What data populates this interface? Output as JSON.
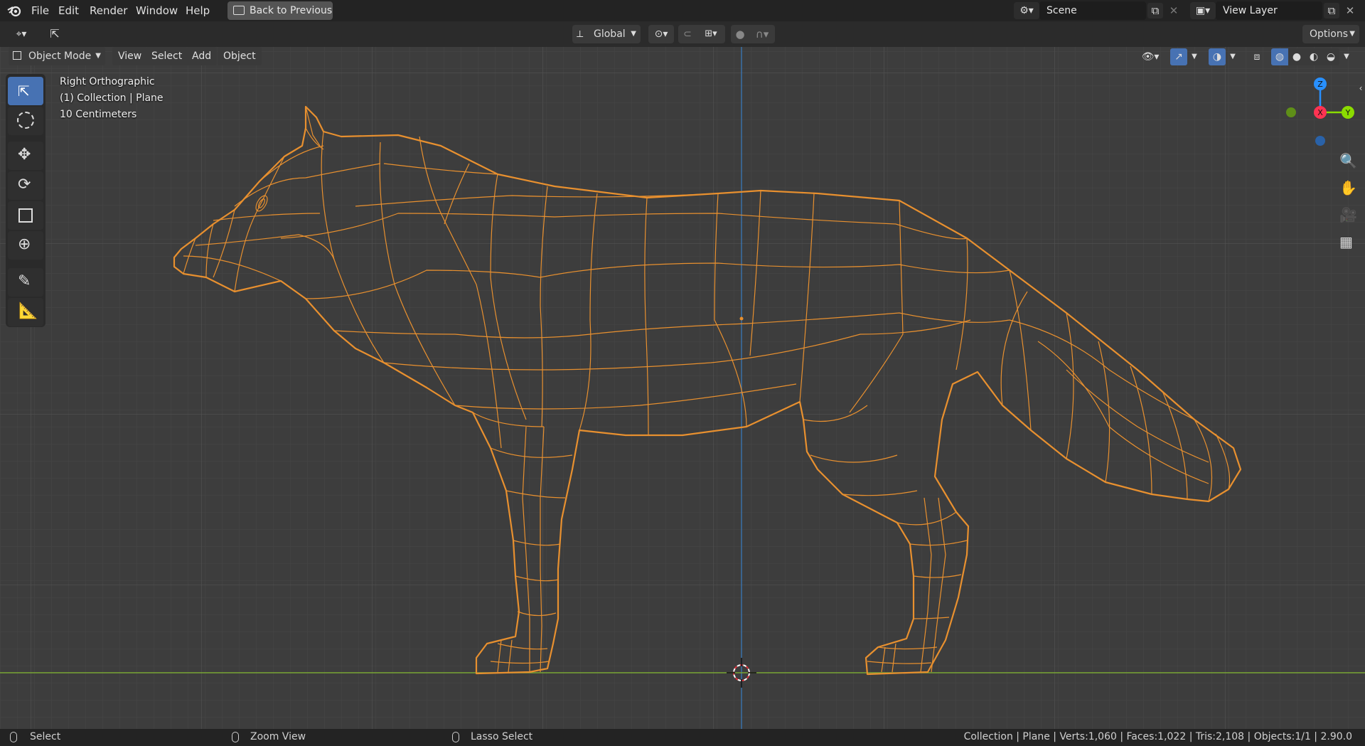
{
  "menu": {
    "file": "File",
    "edit": "Edit",
    "render": "Render",
    "window": "Window",
    "help": "Help"
  },
  "back_button": "Back to Previous",
  "scene": {
    "label": "Scene"
  },
  "view_layer": {
    "label": "View Layer"
  },
  "toolheader": {
    "transform_orientation": "Global",
    "options": "Options"
  },
  "viewport_header": {
    "mode": "Object Mode",
    "view": "View",
    "select": "Select",
    "add": "Add",
    "object": "Object"
  },
  "overlay": {
    "view_name": "Right Orthographic",
    "collection": "(1) Collection | Plane",
    "scale": "10 Centimeters"
  },
  "gizmo": {
    "z": "Z",
    "y": "Y",
    "x": "X"
  },
  "status": {
    "select": "Select",
    "zoom": "Zoom View",
    "lasso": "Lasso Select",
    "stats": "Collection | Plane | Verts:1,060 | Faces:1,022 | Tris:2,108 | Objects:1/1 | 2.90.0"
  },
  "colors": {
    "wire": "#e8902f",
    "accent": "#4772b3",
    "grid_bg": "#3d3d3d",
    "x_axis": "#ff3352",
    "y_axis": "#8bdc00",
    "z_axis": "#2890ff"
  },
  "tools": [
    "select-box",
    "cursor",
    "move",
    "rotate",
    "scale",
    "transform",
    "annotate",
    "measure"
  ],
  "nav_tools": [
    "zoom",
    "pan",
    "camera",
    "grid"
  ]
}
